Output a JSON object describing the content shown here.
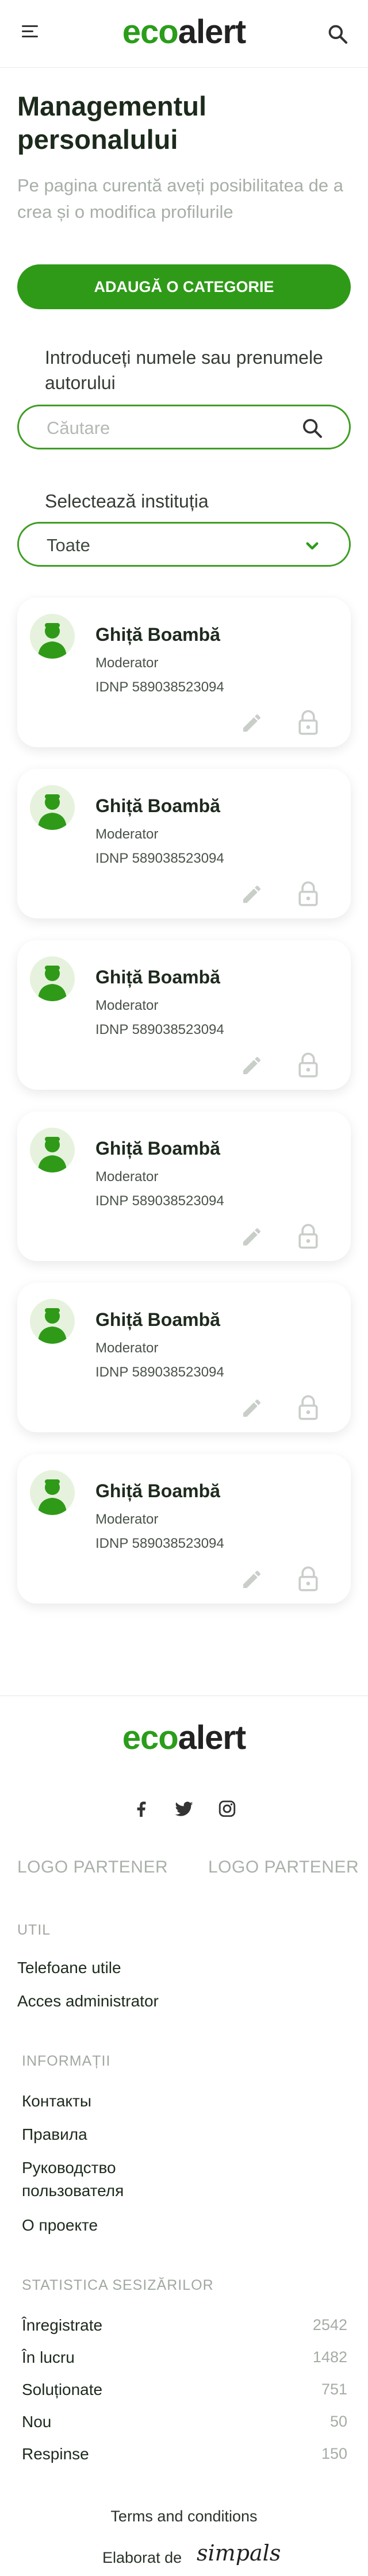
{
  "header": {
    "logo_eco": "eco",
    "logo_alert": "alert"
  },
  "page": {
    "title": "Managementul personalului",
    "subtitle": "Pe pagina curentă aveți posibilitatea de a crea și o modifica profilurile",
    "add_button": "ADAUGĂ O CATEGORIE",
    "search_label": "Introduceți numele sau prenumele autorului",
    "search_placeholder": "Căutare",
    "institution_label": "Selectează instituția",
    "institution_value": "Toate"
  },
  "cards": [
    {
      "name": "Ghiță Boambă",
      "role": "Moderator",
      "idnp": "IDNP 589038523094"
    },
    {
      "name": "Ghiță Boambă",
      "role": "Moderator",
      "idnp": "IDNP 589038523094"
    },
    {
      "name": "Ghiță Boambă",
      "role": "Moderator",
      "idnp": "IDNP 589038523094"
    },
    {
      "name": "Ghiță Boambă",
      "role": "Moderator",
      "idnp": "IDNP 589038523094"
    },
    {
      "name": "Ghiță Boambă",
      "role": "Moderator",
      "idnp": "IDNP 589038523094"
    },
    {
      "name": "Ghiță Boambă",
      "role": "Moderator",
      "idnp": "IDNP 589038523094"
    }
  ],
  "footer": {
    "logo_eco": "eco",
    "logo_alert": "alert",
    "social": [
      "facebook-icon",
      "twitter-icon",
      "instagram-icon"
    ],
    "partners": [
      "LOGO PARTENER",
      "LOGO PARTENER"
    ],
    "util_heading": "UTIL",
    "util_links": [
      "Telefoane utile",
      "Acces administrator"
    ],
    "info_heading": "INFORMAȚII",
    "info_links": [
      "Контакты",
      "Правила",
      "Руководство пользователя",
      "О проекте"
    ],
    "stats_heading": "STATISTICA SESIZĂRILOR",
    "stats": [
      {
        "label": "Înregistrate",
        "value": "2542"
      },
      {
        "label": "În lucru",
        "value": "1482"
      },
      {
        "label": "Soluționate",
        "value": "751"
      },
      {
        "label": "Nou",
        "value": "50"
      },
      {
        "label": "Respinse",
        "value": "150"
      }
    ],
    "terms": "Terms and conditions",
    "elaborat": "Elaborat de",
    "simpals": "simpals"
  },
  "colors": {
    "brand_green": "#2f9a18",
    "text_dark": "#1e2a1e",
    "muted": "#a7aea7"
  }
}
